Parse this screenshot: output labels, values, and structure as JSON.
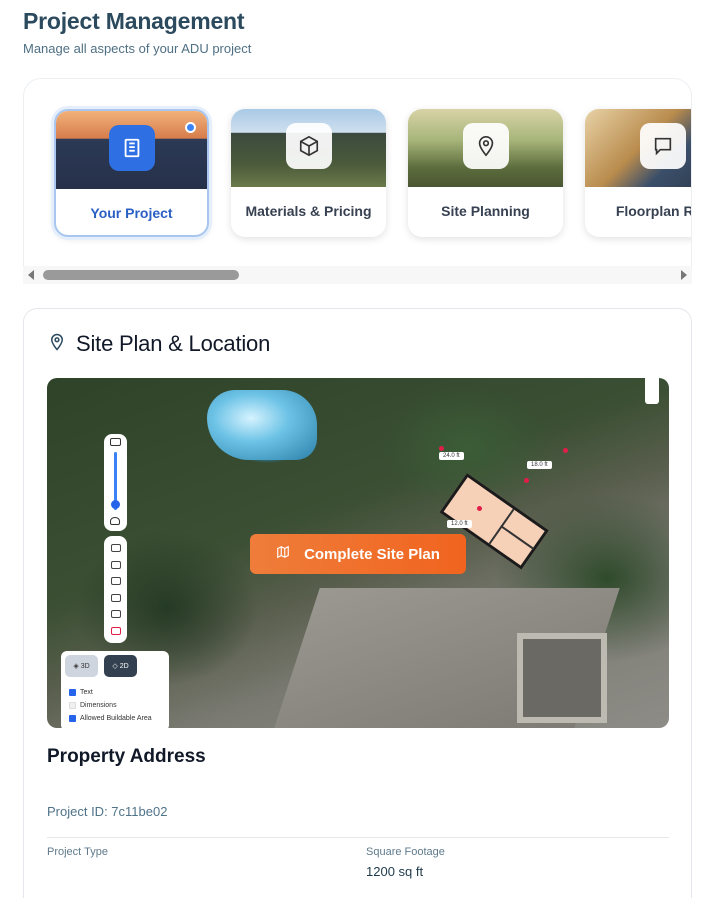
{
  "header": {
    "title": "Project Management",
    "subtitle": "Manage all aspects of your ADU project"
  },
  "carousel": {
    "items": [
      {
        "label": "Your Project",
        "icon": "building-icon",
        "active": true
      },
      {
        "label": "Materials & Pricing",
        "icon": "box-icon",
        "active": false
      },
      {
        "label": "Site Planning",
        "icon": "map-pin-icon",
        "active": false
      },
      {
        "label": "Floorplan Rev",
        "icon": "message-icon",
        "active": false
      }
    ]
  },
  "site_plan": {
    "title": "Site Plan & Location",
    "icon": "map-pin-icon",
    "complete_button": "Complete Site Plan",
    "view_toggle": {
      "three_d": "3D",
      "two_d": "2D",
      "selected": "2D"
    },
    "layers": [
      {
        "label": "Text",
        "checked": true
      },
      {
        "label": "Dimensions",
        "checked": false
      },
      {
        "label": "Allowed Buildable Area",
        "checked": true
      }
    ],
    "dimension_labels": [
      "24.0 ft",
      "18.0 ft",
      "12.0 ft"
    ]
  },
  "property": {
    "title": "Property Address",
    "project_id": "Project ID: 7c11be02",
    "project_type_label": "Project Type",
    "project_type_value": "",
    "square_footage_label": "Square Footage",
    "square_footage_value": "1200 sq ft"
  },
  "colors": {
    "accent_blue": "#2f6fe4",
    "orange_button": "#f0641f",
    "title_color": "#2c4a5e"
  }
}
